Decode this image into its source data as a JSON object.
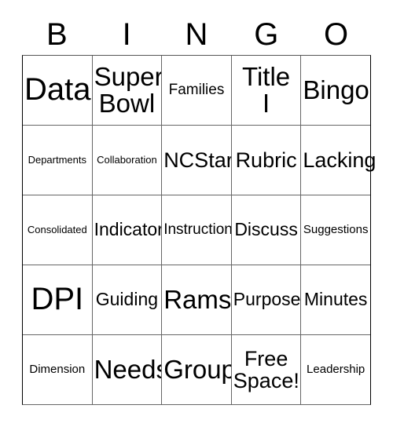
{
  "card": {
    "header_letters": [
      "B",
      "I",
      "N",
      "G",
      "O"
    ],
    "columns": 5,
    "rows": 5,
    "colors": {
      "background": "#ffffff",
      "text": "#000000",
      "grid_line": "#666666",
      "outer_border": "#000000"
    },
    "grid": [
      [
        {
          "label": "Data",
          "size": "xxl"
        },
        {
          "label": "Super\nBowl",
          "size": "xl"
        },
        {
          "label": "Families",
          "size": "sm"
        },
        {
          "label": "Title\nI",
          "size": "xl"
        },
        {
          "label": "Bingo",
          "size": "xl"
        }
      ],
      [
        {
          "label": "Departments",
          "size": "xxs"
        },
        {
          "label": "Collaboration",
          "size": "xxs"
        },
        {
          "label": "NCStar",
          "size": "lg"
        },
        {
          "label": "Rubric",
          "size": "lg"
        },
        {
          "label": "Lacking",
          "size": "lg"
        }
      ],
      [
        {
          "label": "Consolidated",
          "size": "xxs"
        },
        {
          "label": "Indicators",
          "size": "md"
        },
        {
          "label": "Instruction",
          "size": "sm"
        },
        {
          "label": "Discuss",
          "size": "md"
        },
        {
          "label": "Suggestions",
          "size": "xs"
        }
      ],
      [
        {
          "label": "DPI",
          "size": "xxl"
        },
        {
          "label": "Guiding",
          "size": "md"
        },
        {
          "label": "Rams",
          "size": "xl"
        },
        {
          "label": "Purpose",
          "size": "md"
        },
        {
          "label": "Minutes",
          "size": "md"
        }
      ],
      [
        {
          "label": "Dimension",
          "size": "xs"
        },
        {
          "label": "Needs",
          "size": "xl"
        },
        {
          "label": "Group",
          "size": "xl"
        },
        {
          "label": "Free\nSpace!",
          "size": "lg"
        },
        {
          "label": "Leadership",
          "size": "xs"
        }
      ]
    ]
  }
}
